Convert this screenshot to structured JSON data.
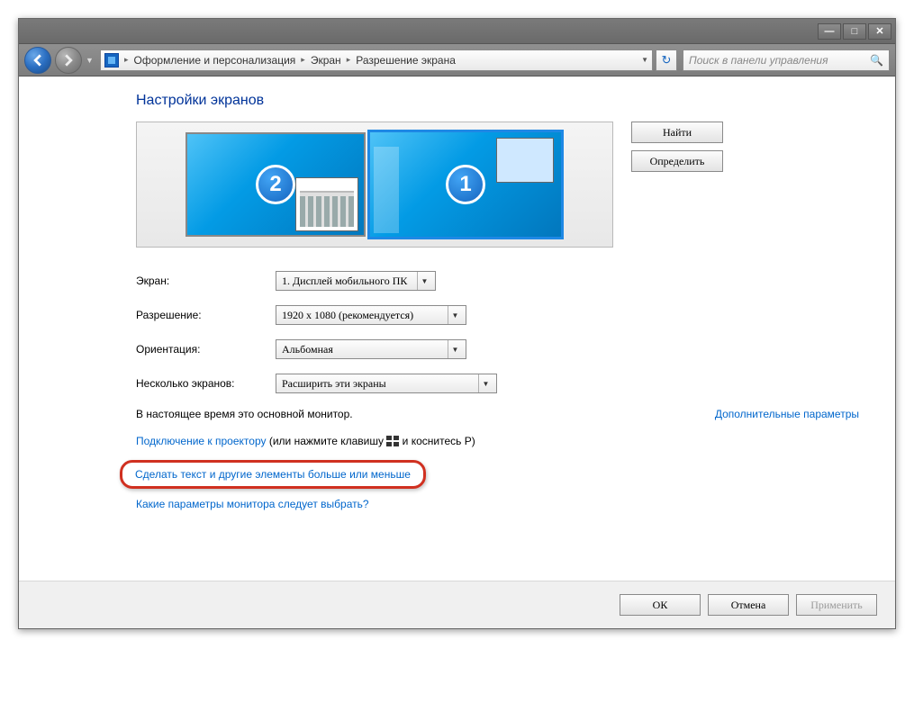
{
  "titlebar": {
    "min": "—",
    "max": "□",
    "close": "✕"
  },
  "nav": {
    "breadcrumb": [
      "Оформление и персонализация",
      "Экран",
      "Разрешение экрана"
    ],
    "search_placeholder": "Поиск в панели управления"
  },
  "heading": "Настройки экранов",
  "monitors": {
    "m2": "2",
    "m1": "1"
  },
  "side_buttons": {
    "find": "Найти",
    "identify": "Определить"
  },
  "fields": {
    "display_label": "Экран:",
    "display_value": "1. Дисплей мобильного ПК",
    "resolution_label": "Разрешение:",
    "resolution_value": "1920 x 1080 (рекомендуется)",
    "orientation_label": "Ориентация:",
    "orientation_value": "Альбомная",
    "multi_label": "Несколько экранов:",
    "multi_value": "Расширить эти экраны"
  },
  "note_main": "В настоящее время это основной монитор.",
  "note_adv": "Дополнительные параметры",
  "projector": {
    "link": "Подключение к проектору",
    "suffix1": " (или нажмите клавишу ",
    "suffix2": " и коснитесь P)"
  },
  "resize_link": "Сделать текст и другие элементы больше или меньше",
  "which_link": "Какие параметры монитора следует выбрать?",
  "footer": {
    "ok": "ОК",
    "cancel": "Отмена",
    "apply": "Применить"
  }
}
